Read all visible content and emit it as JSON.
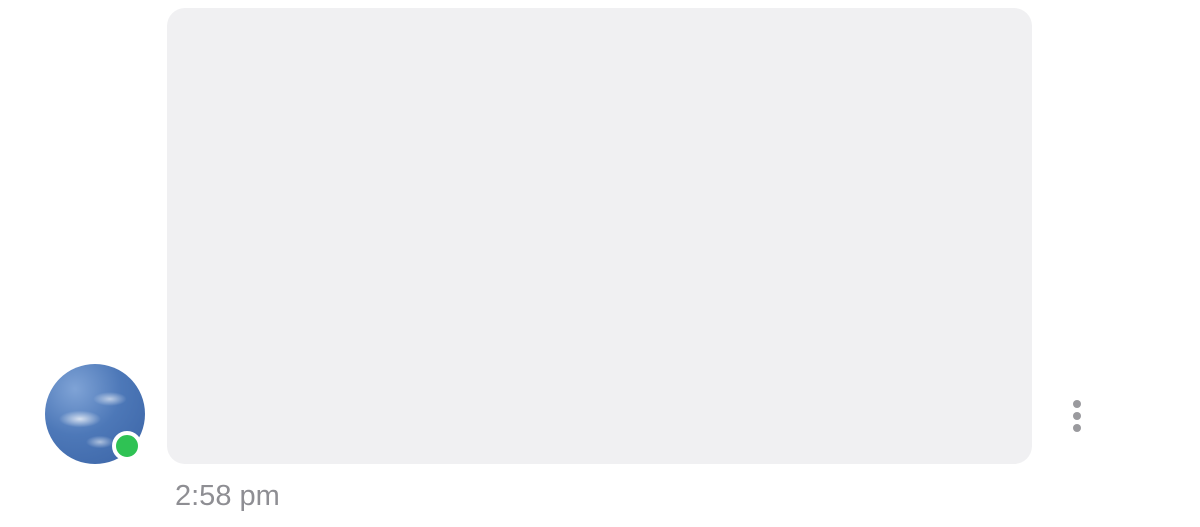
{
  "message": {
    "text": "",
    "timestamp": "2:58 pm"
  },
  "sender": {
    "online": true
  },
  "colors": {
    "bubble_bg": "#f0f0f2",
    "text": "#1c1c1e",
    "online_dot": "#2fc254",
    "timestamp": "#8e8e93"
  }
}
